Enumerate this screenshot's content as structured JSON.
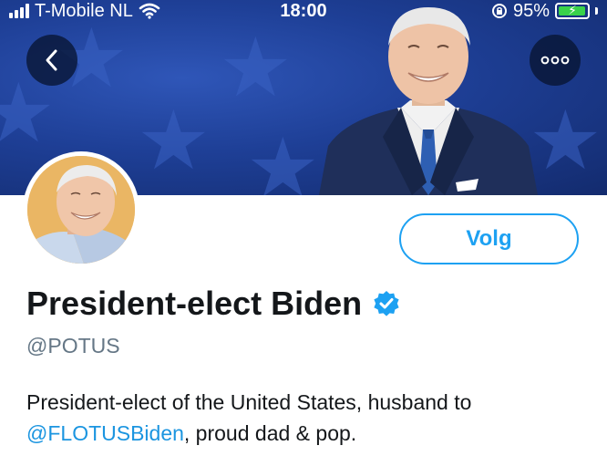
{
  "status_bar": {
    "carrier": "T-Mobile NL",
    "time": "18:00",
    "battery_percent": "95%",
    "battery_level": 0.95
  },
  "nav": {
    "back_icon": "chevron-left-icon",
    "more_icon": "more-horizontal-icon"
  },
  "profile": {
    "follow_label": "Volg",
    "display_name": "President-elect Biden",
    "handle": "@POTUS",
    "bio_line1": "President-elect of the United States, husband to",
    "bio_mention": "@FLOTUSBiden",
    "bio_rest": ", proud dad & pop."
  },
  "colors": {
    "accent": "#1da1f2",
    "banner_blue": "#1e3f96",
    "verified": "#1da1f2"
  }
}
